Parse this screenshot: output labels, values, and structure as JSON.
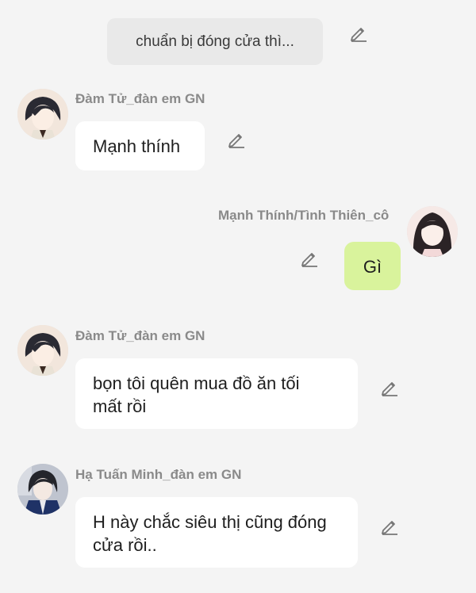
{
  "narration": {
    "text": "chuẩn bị đóng cửa thì..."
  },
  "messages": [
    {
      "sender": "Đàm Tử_đàn em GN",
      "text": "Mạnh thính",
      "avatar": "boy-dark-hair-avatar"
    },
    {
      "sender": "Mạnh Thính/Tình Thiên_cô",
      "text": "Gì",
      "avatar": "girl-long-hair-avatar",
      "bubble_color": "#d9f39c"
    },
    {
      "sender": "Đàm Tử_đàn em GN",
      "text_line1": "bọn tôi quên mua đồ ăn tối",
      "text_line2": "mất rồi",
      "avatar": "boy-dark-hair-avatar"
    },
    {
      "sender": "Hạ Tuấn Minh_đàn em GN",
      "text_line1": "H này chắc siêu thị cũng đóng",
      "text_line2": "cửa rồi..",
      "avatar": "boy-jacket-avatar"
    }
  ],
  "icons": {
    "edit": "pencil-edit-icon"
  }
}
